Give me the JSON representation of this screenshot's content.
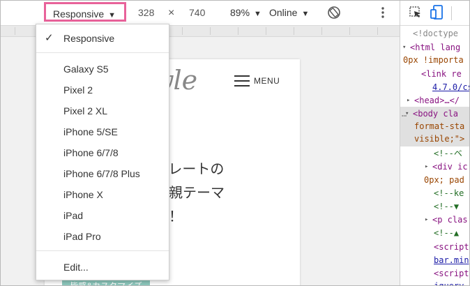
{
  "toolbar": {
    "device": "Responsive",
    "width": "328",
    "times": "×",
    "height": "740",
    "zoom": "89%",
    "network": "Online"
  },
  "dropdown": {
    "selected": "Responsive",
    "devices": [
      "Galaxy S5",
      "Pixel 2",
      "Pixel 2 XL",
      "iPhone 5/SE",
      "iPhone 6/7/8",
      "iPhone 6/7/8 Plus",
      "iPhone X",
      "iPad",
      "iPad Pro"
    ],
    "edit": "Edit..."
  },
  "page": {
    "logo_fragment": "yle",
    "menu_label": "MENU",
    "hero_lines": [
      "テンプレートの",
      "きの、親テーマ",
      "で簡単！"
    ],
    "tag": "皆感&カスタマイズ"
  },
  "elements": {
    "lines": [
      {
        "t": "<!doctype"
      },
      {
        "t": "<html lang"
      },
      {
        "t": "0px !importa"
      },
      {
        "t": "<link re"
      },
      {
        "t": "4.7.0/cs"
      },
      {
        "t": "<head>…</"
      },
      {
        "t": "<body cla"
      },
      {
        "t": "format-sta"
      },
      {
        "t": "visible;\">"
      },
      {
        "t": "<!--ベ"
      },
      {
        "t": "<div ic"
      },
      {
        "t": "0px; pad"
      },
      {
        "t": "<!--ke"
      },
      {
        "t": "<!--▼"
      },
      {
        "t": "<p clas"
      },
      {
        "t": "<!--▲"
      },
      {
        "t": "<script"
      },
      {
        "t": "bar.min"
      },
      {
        "t": "<script"
      },
      {
        "t": "jquery."
      }
    ]
  },
  "colors": {
    "highlight_border": "#e8629a",
    "tag_bg": "#8dc8bd",
    "devtools_blue": "#1a73e8"
  }
}
